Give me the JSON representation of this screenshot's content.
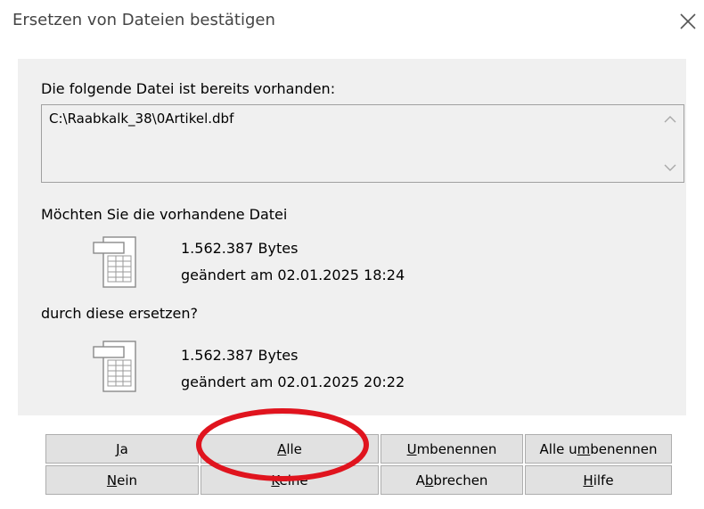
{
  "window": {
    "title": "Ersetzen von Dateien bestätigen",
    "close_icon": "close-icon"
  },
  "dialog": {
    "exists_label": "Die folgende Datei ist bereits vorhanden:",
    "file_path": "C:\\Raabkalk_38\\0Artikel.dbf",
    "question_label": "Möchten Sie die vorhandene Datei",
    "replace_label": "durch diese ersetzen?",
    "existing_file": {
      "size": "1.562.387 Bytes",
      "modified": "geändert am 02.01.2025 18:24",
      "icon": "spreadsheet-file-icon"
    },
    "new_file": {
      "size": "1.562.387 Bytes",
      "modified": "geändert am 02.01.2025 20:22",
      "icon": "spreadsheet-file-icon"
    }
  },
  "buttons": {
    "ja": {
      "mnemonic": "J",
      "rest": "a"
    },
    "alle": {
      "mnemonic": "A",
      "rest": "lle"
    },
    "umbenennen": {
      "mnemonic": "U",
      "rest": "mbenennen"
    },
    "alle_umbenennen": {
      "before": "Alle u",
      "mnemonic": "m",
      "rest": "benennen"
    },
    "nein": {
      "mnemonic": "N",
      "rest": "ein"
    },
    "keine": {
      "mnemonic": "K",
      "rest": "eine"
    },
    "abbrechen": {
      "before": "A",
      "mnemonic": "b",
      "rest": "brechen"
    },
    "hilfe": {
      "mnemonic": "H",
      "rest": "ilfe"
    }
  },
  "annotation": {
    "color": "#e0141e",
    "shape": "ellipse"
  }
}
